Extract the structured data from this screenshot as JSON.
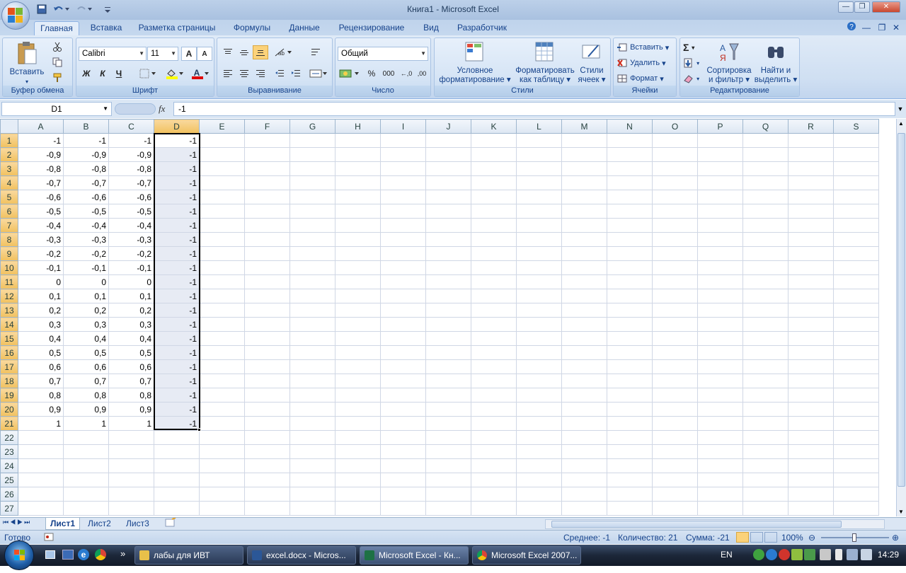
{
  "window": {
    "title": "Книга1 - Microsoft Excel",
    "min": "—",
    "max": "❐",
    "close": "✕"
  },
  "qat": {
    "save_icon": "save-icon",
    "undo_icon": "undo-icon",
    "redo_icon": "redo-icon"
  },
  "tabs": [
    {
      "label": "Главная",
      "active": true
    },
    {
      "label": "Вставка"
    },
    {
      "label": "Разметка страницы"
    },
    {
      "label": "Формулы"
    },
    {
      "label": "Данные"
    },
    {
      "label": "Рецензирование"
    },
    {
      "label": "Вид"
    },
    {
      "label": "Разработчик"
    }
  ],
  "ribbon": {
    "clipboard": {
      "label": "Буфер обмена",
      "paste": "Вставить"
    },
    "font": {
      "label": "Шрифт",
      "name": "Calibri",
      "size": "11",
      "bold": "Ж",
      "italic": "К",
      "underline": "Ч",
      "grow": "A",
      "shrink": "A"
    },
    "alignment": {
      "label": "Выравнивание"
    },
    "number": {
      "label": "Число",
      "format": "Общий",
      "percent": "%",
      "thousands": "000",
      "inc_dec": "←,0",
      "dec_dec": ",00"
    },
    "styles": {
      "label": "Стили",
      "cond_line1": "Условное",
      "cond_line2": "форматирование",
      "table_line1": "Форматировать",
      "table_line2": "как таблицу",
      "cell_line1": "Стили",
      "cell_line2": "ячеек"
    },
    "cells": {
      "label": "Ячейки",
      "insert": "Вставить",
      "delete": "Удалить",
      "format": "Формат"
    },
    "editing": {
      "label": "Редактирование",
      "sigma": "Σ",
      "sort_line1": "Сортировка",
      "sort_line2": "и фильтр",
      "find_line1": "Найти и",
      "find_line2": "выделить"
    }
  },
  "formula_bar": {
    "name_box": "D1",
    "fx": "fx",
    "value": "-1"
  },
  "columns": [
    "A",
    "B",
    "C",
    "D",
    "E",
    "F",
    "G",
    "H",
    "I",
    "J",
    "K",
    "L",
    "M",
    "N",
    "O",
    "P",
    "Q",
    "R",
    "S"
  ],
  "rows": [
    {
      "n": "1",
      "a": "-1",
      "b": "-1",
      "c": "-1",
      "d": "-1"
    },
    {
      "n": "2",
      "a": "-0,9",
      "b": "-0,9",
      "c": "-0,9",
      "d": "-1"
    },
    {
      "n": "3",
      "a": "-0,8",
      "b": "-0,8",
      "c": "-0,8",
      "d": "-1"
    },
    {
      "n": "4",
      "a": "-0,7",
      "b": "-0,7",
      "c": "-0,7",
      "d": "-1"
    },
    {
      "n": "5",
      "a": "-0,6",
      "b": "-0,6",
      "c": "-0,6",
      "d": "-1"
    },
    {
      "n": "6",
      "a": "-0,5",
      "b": "-0,5",
      "c": "-0,5",
      "d": "-1"
    },
    {
      "n": "7",
      "a": "-0,4",
      "b": "-0,4",
      "c": "-0,4",
      "d": "-1"
    },
    {
      "n": "8",
      "a": "-0,3",
      "b": "-0,3",
      "c": "-0,3",
      "d": "-1"
    },
    {
      "n": "9",
      "a": "-0,2",
      "b": "-0,2",
      "c": "-0,2",
      "d": "-1"
    },
    {
      "n": "10",
      "a": "-0,1",
      "b": "-0,1",
      "c": "-0,1",
      "d": "-1"
    },
    {
      "n": "11",
      "a": "0",
      "b": "0",
      "c": "0",
      "d": "-1"
    },
    {
      "n": "12",
      "a": "0,1",
      "b": "0,1",
      "c": "0,1",
      "d": "-1"
    },
    {
      "n": "13",
      "a": "0,2",
      "b": "0,2",
      "c": "0,2",
      "d": "-1"
    },
    {
      "n": "14",
      "a": "0,3",
      "b": "0,3",
      "c": "0,3",
      "d": "-1"
    },
    {
      "n": "15",
      "a": "0,4",
      "b": "0,4",
      "c": "0,4",
      "d": "-1"
    },
    {
      "n": "16",
      "a": "0,5",
      "b": "0,5",
      "c": "0,5",
      "d": "-1"
    },
    {
      "n": "17",
      "a": "0,6",
      "b": "0,6",
      "c": "0,6",
      "d": "-1"
    },
    {
      "n": "18",
      "a": "0,7",
      "b": "0,7",
      "c": "0,7",
      "d": "-1"
    },
    {
      "n": "19",
      "a": "0,8",
      "b": "0,8",
      "c": "0,8",
      "d": "-1"
    },
    {
      "n": "20",
      "a": "0,9",
      "b": "0,9",
      "c": "0,9",
      "d": "-1"
    },
    {
      "n": "21",
      "a": "1",
      "b": "1",
      "c": "1",
      "d": "-1"
    },
    {
      "n": "22",
      "a": "",
      "b": "",
      "c": "",
      "d": ""
    },
    {
      "n": "23",
      "a": "",
      "b": "",
      "c": "",
      "d": ""
    },
    {
      "n": "24",
      "a": "",
      "b": "",
      "c": "",
      "d": ""
    },
    {
      "n": "25",
      "a": "",
      "b": "",
      "c": "",
      "d": ""
    },
    {
      "n": "26",
      "a": "",
      "b": "",
      "c": "",
      "d": ""
    },
    {
      "n": "27",
      "a": "",
      "b": "",
      "c": "",
      "d": ""
    }
  ],
  "sheet_tabs": [
    {
      "label": "Лист1",
      "active": true
    },
    {
      "label": "Лист2"
    },
    {
      "label": "Лист3"
    }
  ],
  "status": {
    "ready": "Готово",
    "average": "Среднее: -1",
    "count": "Количество: 21",
    "sum": "Сумма: -21",
    "zoom": "100%"
  },
  "taskbar": {
    "items": [
      {
        "label": "лабы для ИВТ",
        "color": "#e8c04a"
      },
      {
        "label": "excel.docx - Micros...",
        "color": "#2b5797"
      },
      {
        "label": "Microsoft Excel - Кн...",
        "color": "#1e7145",
        "active": true
      },
      {
        "label": "Microsoft Excel 2007...",
        "color": "#d94f2b"
      }
    ],
    "lang": "EN",
    "clock": "14:29",
    "chevron": "»"
  }
}
